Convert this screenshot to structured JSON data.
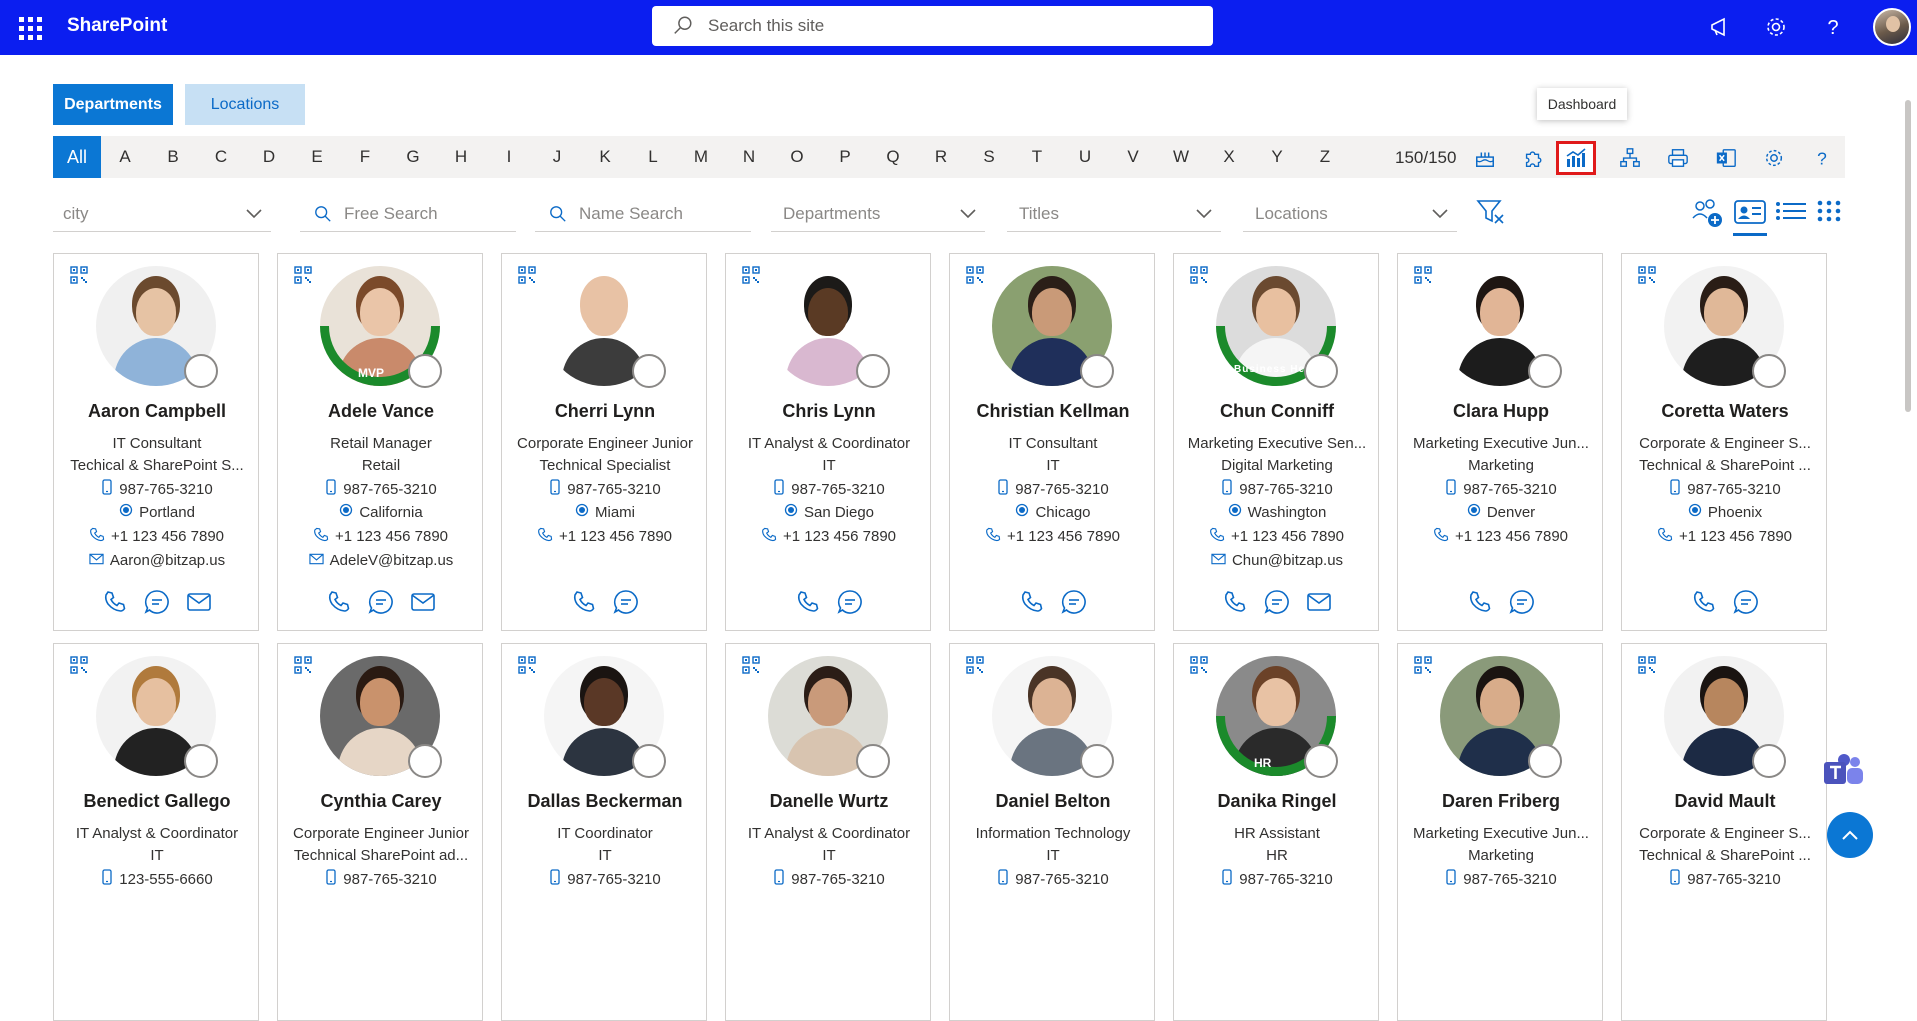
{
  "header": {
    "brand": "SharePoint",
    "search_placeholder": "Search this site"
  },
  "tabs": [
    {
      "label": "Departments",
      "active": true
    },
    {
      "label": "Locations",
      "active": false
    }
  ],
  "alphabet": [
    "All",
    "A",
    "B",
    "C",
    "D",
    "E",
    "F",
    "G",
    "H",
    "I",
    "J",
    "K",
    "L",
    "M",
    "N",
    "O",
    "P",
    "Q",
    "R",
    "S",
    "T",
    "U",
    "V",
    "W",
    "X",
    "Y",
    "Z"
  ],
  "count": "150/150",
  "tooltip": "Dashboard",
  "filters": {
    "city": "city",
    "free_search": "Free Search",
    "name_search": "Name Search",
    "departments": "Departments",
    "titles": "Titles",
    "locations": "Locations"
  },
  "people": [
    {
      "name": "Aaron Campbell",
      "title": "IT Consultant",
      "dept": "Techical & SharePoint S...",
      "mobile": "987-765-3210",
      "city": "Portland",
      "phone": "+1 123 456 7890",
      "email": "Aaron@bitzap.us",
      "badge": "",
      "skin": "#e6c3a4",
      "hair": "#6b4a2e",
      "shirt": "#8fb3d9",
      "bg": "#f0f0f0"
    },
    {
      "name": "Adele Vance",
      "title": "Retail Manager",
      "dept": "Retail",
      "mobile": "987-765-3210",
      "city": "California",
      "phone": "+1 123 456 7890",
      "email": "AdeleV@bitzap.us",
      "badge": "MVP",
      "skin": "#eac5a8",
      "hair": "#7b4a2a",
      "shirt": "#c98a6b",
      "bg": "#e9e2d8"
    },
    {
      "name": "Cherri Lynn",
      "title": "Corporate Engineer Junior",
      "dept": "Technical Specialist",
      "mobile": "987-765-3210",
      "city": "Miami",
      "phone": "+1 123 456 7890",
      "email": "",
      "badge": "",
      "skin": "#e8c2a5",
      "hair": "#e8c2a5",
      "shirt": "#3c3c3c",
      "bg": "#ffffff"
    },
    {
      "name": "Chris Lynn",
      "title": "IT Analyst & Coordinator",
      "dept": "IT",
      "mobile": "987-765-3210",
      "city": "San Diego",
      "phone": "+1 123 456 7890",
      "email": "",
      "badge": "",
      "skin": "#5a3a24",
      "hair": "#1c1a18",
      "shirt": "#d9b8d0",
      "bg": "#ffffff"
    },
    {
      "name": "Christian Kellman",
      "title": "IT Consultant",
      "dept": "IT",
      "mobile": "987-765-3210",
      "city": "Chicago",
      "phone": "+1 123 456 7890",
      "email": "",
      "badge": "",
      "skin": "#c99a78",
      "hair": "#2b1f18",
      "shirt": "#1f2f5a",
      "bg": "#8aa070"
    },
    {
      "name": "Chun Conniff",
      "title": "Marketing Executive Sen...",
      "dept": "Digital Marketing",
      "mobile": "987-765-3210",
      "city": "Washington",
      "phone": "+1 123 456 7890",
      "email": "Chun@bitzap.us",
      "badge": "Business Head",
      "skin": "#e8c0a0",
      "hair": "#6b4a30",
      "shirt": "#f5f5f5",
      "bg": "#dcdcdc"
    },
    {
      "name": "Clara Hupp",
      "title": "Marketing Executive Jun...",
      "dept": "Marketing",
      "mobile": "987-765-3210",
      "city": "Denver",
      "phone": "+1 123 456 7890",
      "email": "",
      "badge": "",
      "skin": "#e1b596",
      "hair": "#1e1612",
      "shirt": "#1c1c1c",
      "bg": "#ffffff"
    },
    {
      "name": "Coretta Waters",
      "title": "Corporate & Engineer S...",
      "dept": "Technical & SharePoint ...",
      "mobile": "987-765-3210",
      "city": "Phoenix",
      "phone": "+1 123 456 7890",
      "email": "",
      "badge": "",
      "skin": "#e0b898",
      "hair": "#2a1d16",
      "shirt": "#1e1e1e",
      "bg": "#f2f2f2"
    },
    {
      "name": "Benedict Gallego",
      "title": "IT Analyst & Coordinator",
      "dept": "IT",
      "mobile": "123-555-6660",
      "city": "",
      "phone": "",
      "email": "",
      "badge": "",
      "skin": "#e6c0a0",
      "hair": "#b07a3c",
      "shirt": "#222222",
      "bg": "#f2f2f2"
    },
    {
      "name": "Cynthia Carey",
      "title": "Corporate Engineer Junior",
      "dept": "Technical SharePoint ad...",
      "mobile": "987-765-3210",
      "city": "",
      "phone": "",
      "email": "",
      "badge": "",
      "skin": "#c9926c",
      "hair": "#2a1a12",
      "shirt": "#e6d6c6",
      "bg": "#6a6a6a"
    },
    {
      "name": "Dallas Beckerman",
      "title": "IT Coordinator",
      "dept": "IT",
      "mobile": "987-765-3210",
      "city": "",
      "phone": "",
      "email": "",
      "badge": "",
      "skin": "#5a3826",
      "hair": "#1a1411",
      "shirt": "#2c3440",
      "bg": "#f5f5f5"
    },
    {
      "name": "Danelle Wurtz",
      "title": "IT Analyst & Coordinator",
      "dept": "IT",
      "mobile": "987-765-3210",
      "city": "",
      "phone": "",
      "email": "",
      "badge": "",
      "skin": "#c99a7a",
      "hair": "#2b1d16",
      "shirt": "#d8c4b0",
      "bg": "#dcdcd6"
    },
    {
      "name": "Daniel Belton",
      "title": "Information Technology",
      "dept": "IT",
      "mobile": "987-765-3210",
      "city": "",
      "phone": "",
      "email": "",
      "badge": "",
      "skin": "#dcb394",
      "hair": "#4a3426",
      "shirt": "#6a7480",
      "bg": "#f5f5f5"
    },
    {
      "name": "Danika Ringel",
      "title": "HR Assistant",
      "dept": "HR",
      "mobile": "987-765-3210",
      "city": "",
      "phone": "",
      "email": "",
      "badge": "HR",
      "skin": "#e8c2a4",
      "hair": "#6b4228",
      "shirt": "#2a2a2a",
      "bg": "#8a8a8a"
    },
    {
      "name": "Daren Friberg",
      "title": "Marketing Executive Jun...",
      "dept": "Marketing",
      "mobile": "987-765-3210",
      "city": "",
      "phone": "",
      "email": "",
      "badge": "",
      "skin": "#d8ac8a",
      "hair": "#1a1411",
      "shirt": "#1f2f4a",
      "bg": "#8a9a7a"
    },
    {
      "name": "David Mault",
      "title": "Corporate & Engineer S...",
      "dept": "Technical & SharePoint ...",
      "mobile": "987-765-3210",
      "city": "",
      "phone": "",
      "email": "",
      "badge": "",
      "skin": "#b7865e",
      "hair": "#1a1411",
      "shirt": "#1c2a44",
      "bg": "#f2f2f2"
    }
  ]
}
